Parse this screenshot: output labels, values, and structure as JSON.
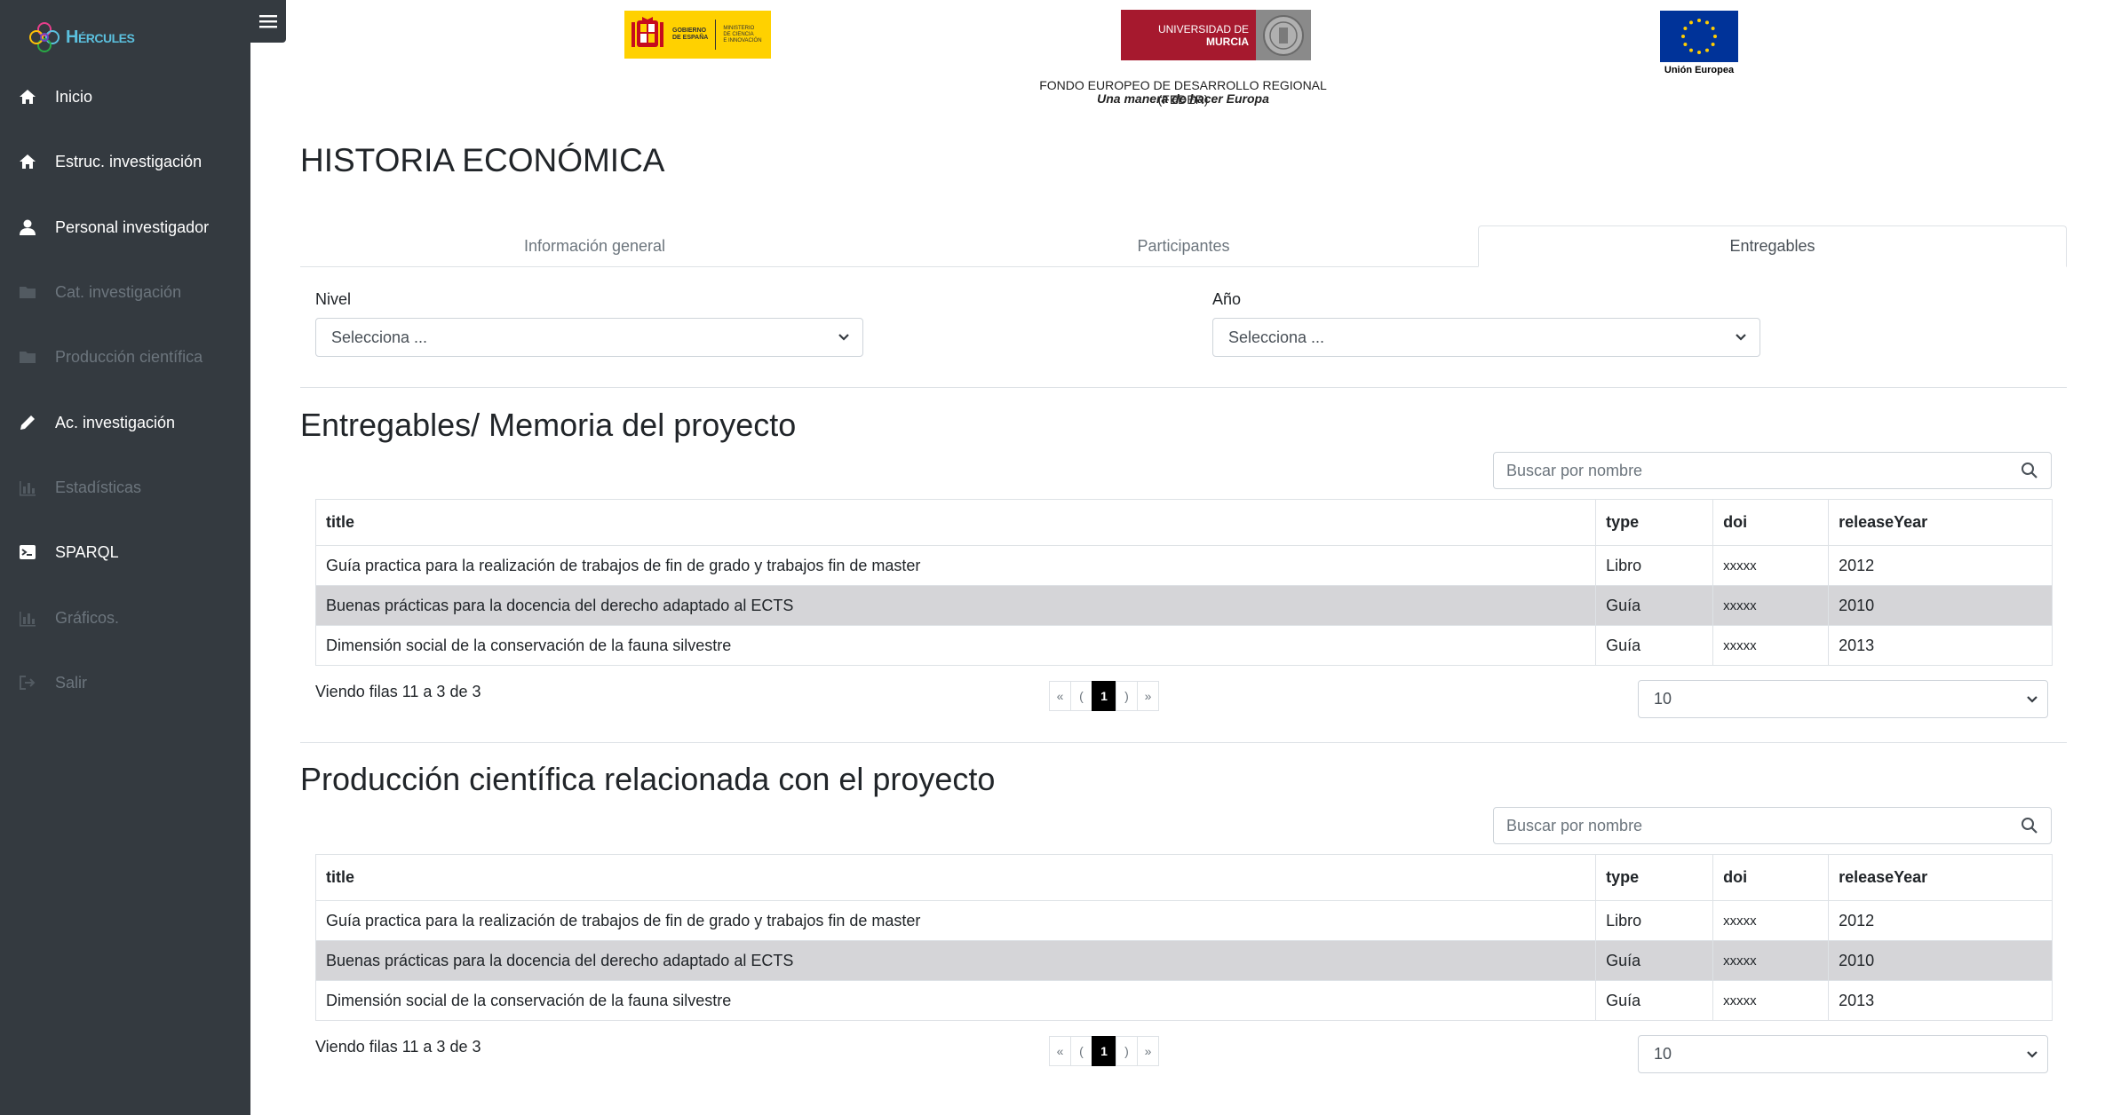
{
  "sidebar": {
    "brand": "Hércules",
    "items": [
      {
        "label": "Inicio",
        "icon": "home-icon",
        "enabled": true
      },
      {
        "label": "Estruc. investigación",
        "icon": "home-icon",
        "enabled": true
      },
      {
        "label": "Personal investigador",
        "icon": "user-icon",
        "enabled": true
      },
      {
        "label": "Cat. investigación",
        "icon": "folder-icon",
        "enabled": false
      },
      {
        "label": "Producción científica",
        "icon": "folder-icon",
        "enabled": false
      },
      {
        "label": "Ac. investigación",
        "icon": "pencil-icon",
        "enabled": true
      },
      {
        "label": "Estadísticas",
        "icon": "bar-chart-icon",
        "enabled": false
      },
      {
        "label": "SPARQL",
        "icon": "terminal-icon",
        "enabled": true
      },
      {
        "label": "Gráficos.",
        "icon": "bar-chart-icon",
        "enabled": false
      },
      {
        "label": "Salir",
        "icon": "logout-icon",
        "enabled": false
      }
    ]
  },
  "header": {
    "gobierno_logo_text": [
      "GOBIERNO",
      "DE ESPAÑA"
    ],
    "ministerio_logo_text": [
      "MINISTERIO",
      "DE CIENCIA",
      "E INNOVACIÓN"
    ],
    "um_logo_text": [
      "UNIVERSIDAD DE",
      "MURCIA"
    ],
    "eu_caption": "Unión Europea",
    "feder_line1": "FONDO EUROPEO DE DESARROLLO REGIONAL (FEDER)",
    "feder_line2": "Una manera de hacer Europa"
  },
  "page_title": "HISTORIA ECONÓMICA",
  "tabs": [
    {
      "label": "Información general",
      "active": false
    },
    {
      "label": "Participantes",
      "active": false
    },
    {
      "label": "Entregables",
      "active": true
    }
  ],
  "filters": {
    "nivel": {
      "label": "Nivel",
      "value": "Selecciona ..."
    },
    "anio": {
      "label": "Año",
      "value": "Selecciona ..."
    }
  },
  "sections": [
    {
      "title": "Entregables/ Memoria del proyecto",
      "search_placeholder": "Buscar por nombre",
      "columns": [
        "title",
        "type",
        "doi",
        "releaseYear"
      ],
      "rows": [
        [
          "Guía practica para la realización de trabajos de fin de grado y trabajos fin de master",
          "Libro",
          "xxxxx",
          "2012"
        ],
        [
          "Buenas prácticas para la docencia del derecho adaptado al ECTS",
          "Guía",
          "xxxxx",
          "2010"
        ],
        [
          "Dimensión social de la conservación de la fauna silvestre",
          "Guía",
          "xxxxx",
          "2013"
        ]
      ],
      "footer": "Viendo filas 11 a 3 de 3",
      "pager": {
        "first": "«",
        "prev": "(",
        "current": "1",
        "next": ")",
        "last": "»"
      },
      "page_size": "10"
    },
    {
      "title": "Producción científica relacionada con el proyecto",
      "search_placeholder": "Buscar por nombre",
      "columns": [
        "title",
        "type",
        "doi",
        "releaseYear"
      ],
      "rows": [
        [
          "Guía practica para la realización de trabajos de fin de grado y trabajos fin de master",
          "Libro",
          "xxxxx",
          "2012"
        ],
        [
          "Buenas prácticas para la docencia del derecho adaptado al ECTS",
          "Guía",
          "xxxxx",
          "2010"
        ],
        [
          "Dimensión social de la conservación de la fauna silvestre",
          "Guía",
          "xxxxx",
          "2013"
        ]
      ],
      "footer": "Viendo filas 11 a 3 de 3",
      "pager": {
        "first": "«",
        "prev": "(",
        "current": "1",
        "next": ")",
        "last": "»"
      },
      "page_size": "10"
    }
  ],
  "colors": {
    "sidebar_bg": "#343a40",
    "highlight_row": "#d5d5d8",
    "um_red": "#a6192e",
    "eu_blue": "#003399",
    "gob_yellow": "#ffd100",
    "brand_cyan": "#5bc0de"
  }
}
